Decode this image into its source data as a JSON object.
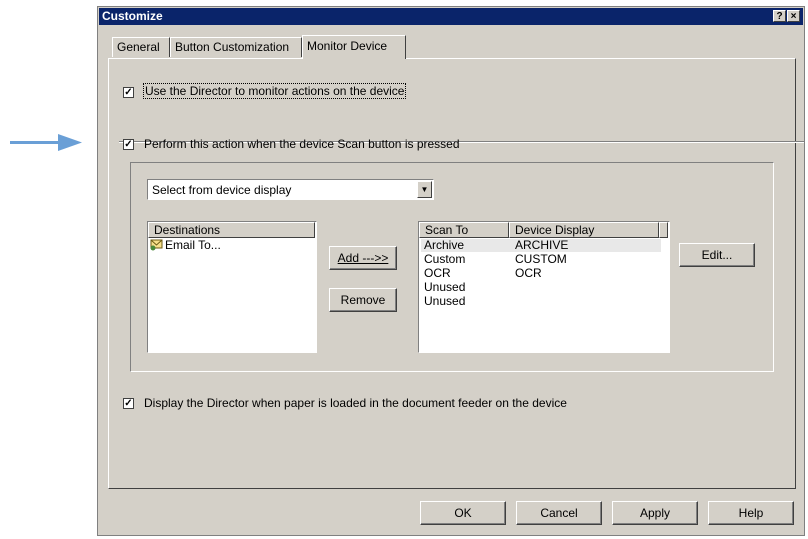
{
  "window": {
    "title": "Customize",
    "help_glyph": "?",
    "close_glyph": "×"
  },
  "tabs": [
    {
      "label": "General",
      "active": false
    },
    {
      "label": "Button Customization",
      "active": false
    },
    {
      "label": "Monitor Device",
      "active": true
    }
  ],
  "monitor": {
    "use_director": {
      "label": "Use the Director to monitor actions on the device",
      "checked": true
    },
    "perform_action": {
      "label": "Perform this action when the device Scan button is pressed",
      "checked": true
    },
    "display_director": {
      "label": "Display the Director when paper is loaded in the document feeder on the device",
      "checked": true
    }
  },
  "action_select": {
    "value": "Select from device display"
  },
  "destinations": {
    "header": "Destinations",
    "items": [
      {
        "label": "Email To...",
        "icon": "mail-icon"
      }
    ]
  },
  "buttons": {
    "add": "Add --->>",
    "remove": "Remove",
    "edit": "Edit...",
    "ok": "OK",
    "cancel": "Cancel",
    "apply": "Apply",
    "help": "Help"
  },
  "scan_table": {
    "headers": [
      "Scan To",
      "Device Display"
    ],
    "rows": [
      {
        "scan_to": "Archive",
        "display": "ARCHIVE",
        "selected": true
      },
      {
        "scan_to": "Custom",
        "display": "CUSTOM"
      },
      {
        "scan_to": "OCR",
        "display": "OCR"
      },
      {
        "scan_to": "Unused",
        "display": ""
      },
      {
        "scan_to": "Unused",
        "display": ""
      }
    ]
  },
  "colors": {
    "title_bar": "#0a246a",
    "dialog_face": "#d4d0c8",
    "arrow": "#6a9fd6"
  }
}
